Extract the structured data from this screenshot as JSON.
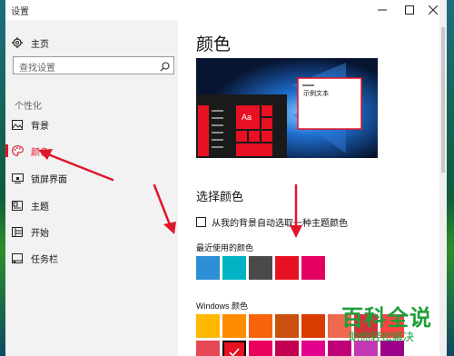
{
  "window": {
    "title": "设置",
    "buttons": [
      "minimize",
      "maximize",
      "close"
    ]
  },
  "sidebar": {
    "home_label": "主页",
    "search_placeholder": "查找设置",
    "section_label": "个性化",
    "items": [
      {
        "label": "背景",
        "icon": "image-icon",
        "active": false
      },
      {
        "label": "颜色",
        "icon": "palette-icon",
        "active": true
      },
      {
        "label": "锁屏界面",
        "icon": "lock-screen-icon",
        "active": false
      },
      {
        "label": "主题",
        "icon": "theme-icon",
        "active": false
      },
      {
        "label": "开始",
        "icon": "start-grid-icon",
        "active": false
      },
      {
        "label": "任务栏",
        "icon": "taskbar-icon",
        "active": false
      }
    ]
  },
  "main": {
    "title": "颜色",
    "preview": {
      "window_text": "示例文本",
      "tile_text": "Aa"
    },
    "choose_title": "选择颜色",
    "auto_pick_label": "从我的背景自动选取一种主题颜色",
    "auto_pick_checked": false,
    "recent_label": "最近使用的颜色",
    "recent_colors": [
      "#2d8fd5",
      "#00b4c4",
      "#4c4a48",
      "#e81123",
      "#e3005f"
    ],
    "windows_label": "Windows 颜色",
    "windows_colors_row1": [
      "#ffb900",
      "#ff8c00",
      "#f7630c",
      "#ca5010",
      "#da3b01",
      "#ef6950",
      "#d13438",
      "#ff4343"
    ],
    "windows_colors_row2": [
      "#e74856",
      "#e81123",
      "#ea005e",
      "#c30052",
      "#e3008c",
      "#bf0077",
      "#c239b3",
      "#9a0089"
    ],
    "selected_color": "#e81123"
  },
  "watermark": {
    "line1": "百科全说",
    "line2": "助你轻松解决"
  }
}
